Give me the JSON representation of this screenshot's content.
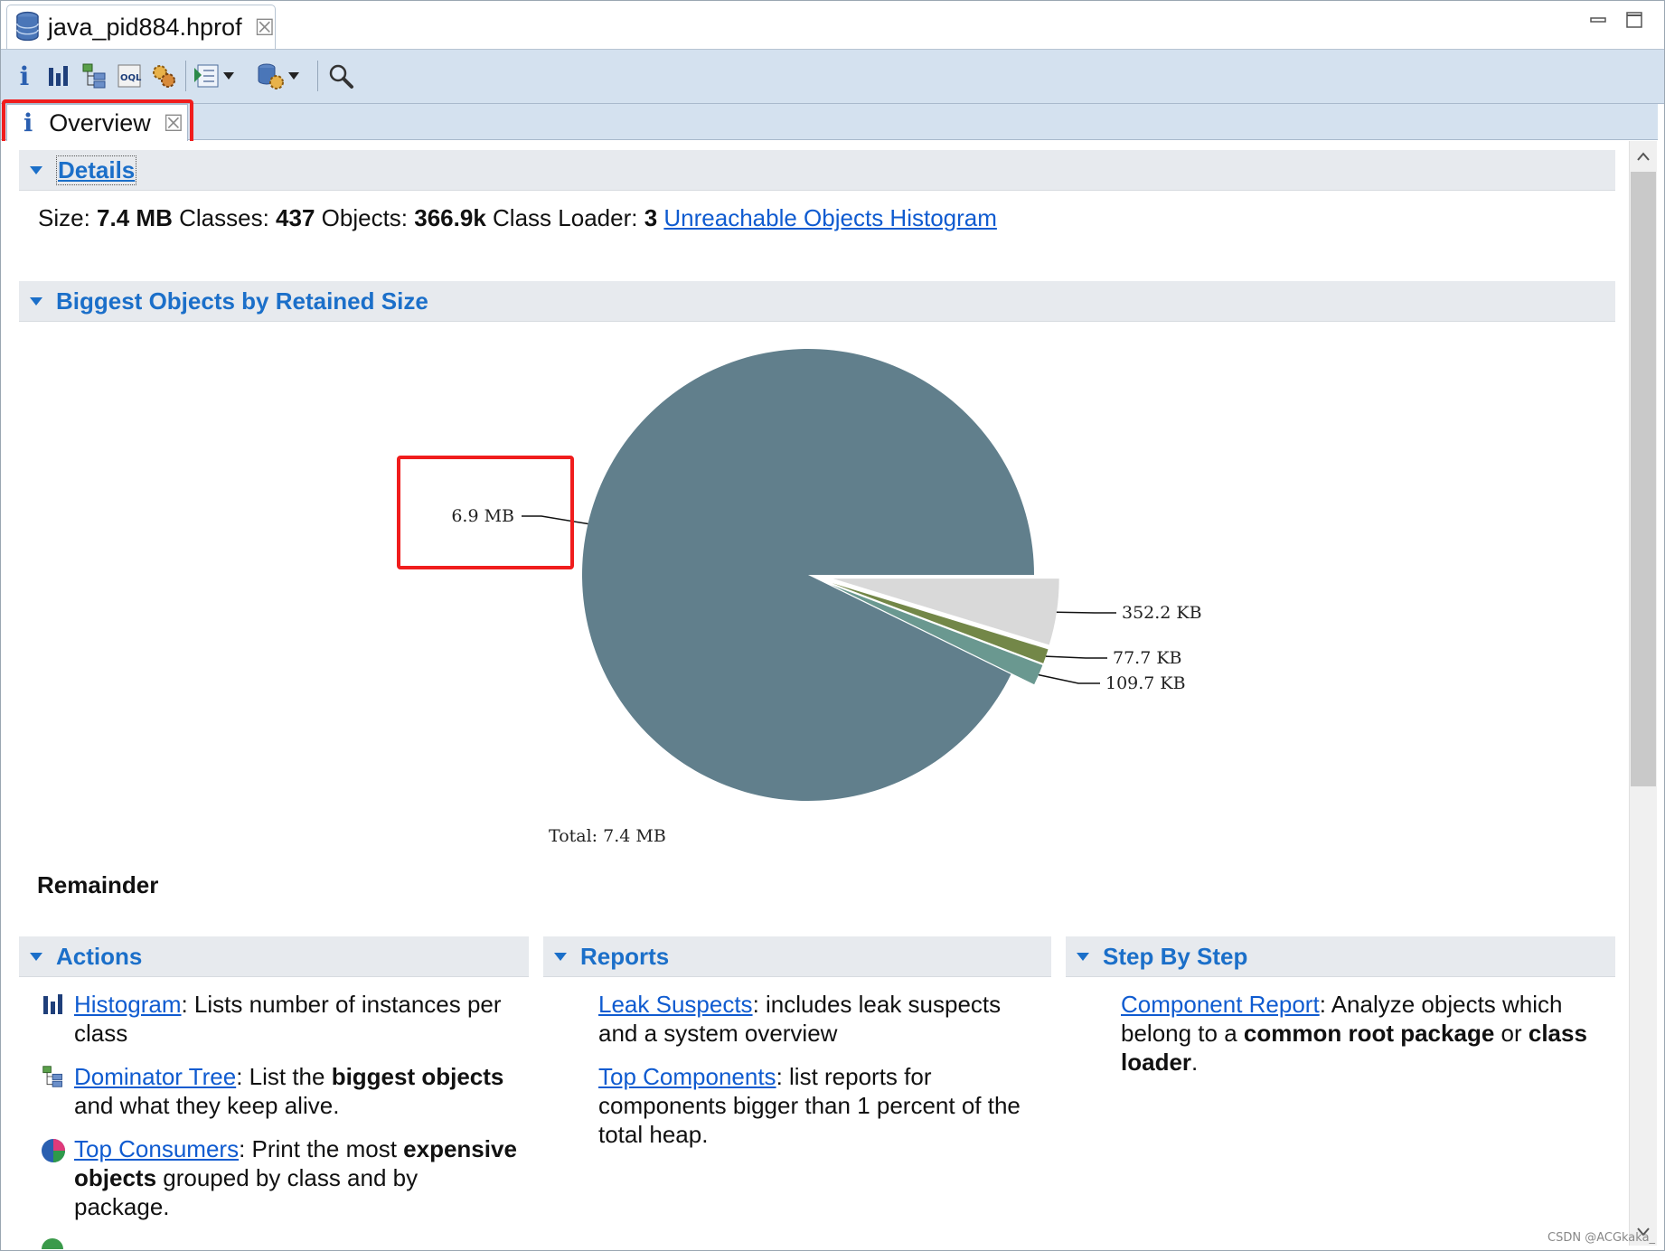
{
  "editor_tab": {
    "title": "java_pid884.hprof"
  },
  "view_tab": {
    "title": "Overview"
  },
  "toolbar": {
    "icons": [
      "info-icon",
      "histogram-icon",
      "dominator-tree-icon",
      "oql-icon",
      "heap-dump-overview-icon",
      "query-browser-icon",
      "run-report-icon",
      "search-icon"
    ]
  },
  "details": {
    "title": "Details",
    "size_label": "Size:",
    "size_value": "7.4 MB",
    "classes_label": "Classes:",
    "classes_value": "437",
    "objects_label": "Objects:",
    "objects_value": "366.9k",
    "classloader_label": "Class Loader:",
    "classloader_value": "3",
    "unreachable_link": "Unreachable Objects Histogram"
  },
  "biggest": {
    "title": "Biggest Objects by Retained Size",
    "total": "Total: 7.4 MB",
    "remainder": "Remainder"
  },
  "chart_data": {
    "type": "pie",
    "title": "",
    "total": "7.4 MB",
    "slices": [
      {
        "label": "6.9 MB",
        "value_kb": 6900,
        "color": "#617f8c"
      },
      {
        "label": "352.2 KB",
        "value_kb": 352.2,
        "color": "#d9d9d9"
      },
      {
        "label": "77.7 KB",
        "value_kb": 77.7,
        "color": "#738748"
      },
      {
        "label": "109.7 KB",
        "value_kb": 109.7,
        "color": "#6a9890"
      }
    ]
  },
  "actions": {
    "title": "Actions",
    "histogram": {
      "link": "Histogram",
      "text": ": Lists number of instances per class"
    },
    "dominator": {
      "link": "Dominator Tree",
      "text1": ": List the ",
      "bold": "biggest objects",
      "text2": " and what they keep alive."
    },
    "consumers": {
      "link": "Top Consumers",
      "text1": ": Print the most ",
      "bold": "expensive objects",
      "text2": " grouped by class and by package."
    }
  },
  "reports": {
    "title": "Reports",
    "leak": {
      "link": "Leak Suspects",
      "text": ": includes leak suspects and a system overview"
    },
    "components": {
      "link": "Top Components",
      "text": ": list reports for components bigger than 1 percent of the total heap."
    }
  },
  "stepbystep": {
    "title": "Step By Step",
    "component": {
      "link": "Component Report",
      "text1": ": Analyze objects which belong to a ",
      "bold1": "common root package",
      "text2": " or ",
      "bold2": "class loader",
      "text3": "."
    }
  },
  "watermark": "CSDN @ACGkaka_",
  "colors": {
    "link": "#0f5bd0",
    "section_title": "#1b6fc9",
    "highlight": "#f01d1d",
    "toolbar_bg": "#d4e1ef"
  }
}
